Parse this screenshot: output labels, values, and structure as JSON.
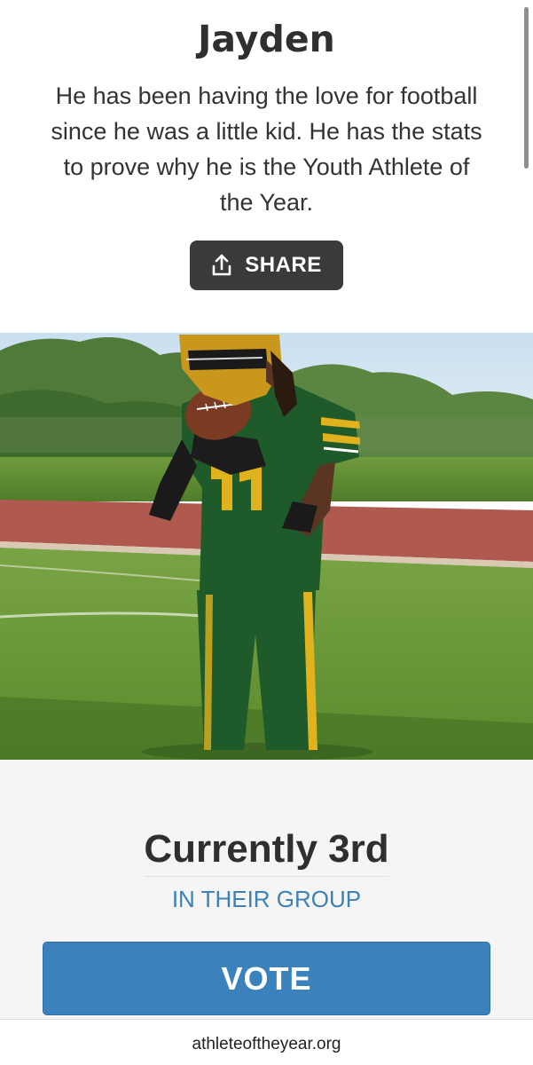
{
  "profile": {
    "name": "Jayden",
    "bio": "He has been having the love for football since he was a little kid. He has the stats to prove why he is the Youth Athlete of the Year.",
    "share_label": "SHARE"
  },
  "photo": {
    "subject": "football player in green and gold uniform catching a football"
  },
  "standing": {
    "rank_text": "Currently 3rd",
    "group_text": "IN THEIR GROUP",
    "vote_label": "VOTE"
  },
  "browser": {
    "domain": "athleteoftheyear.org"
  },
  "colors": {
    "share_button": "#3a3a3a",
    "vote_button": "#3b82bc",
    "group_text": "#3b82b8",
    "uniform_green": "#1f5a2a",
    "uniform_gold": "#e0b21e"
  }
}
